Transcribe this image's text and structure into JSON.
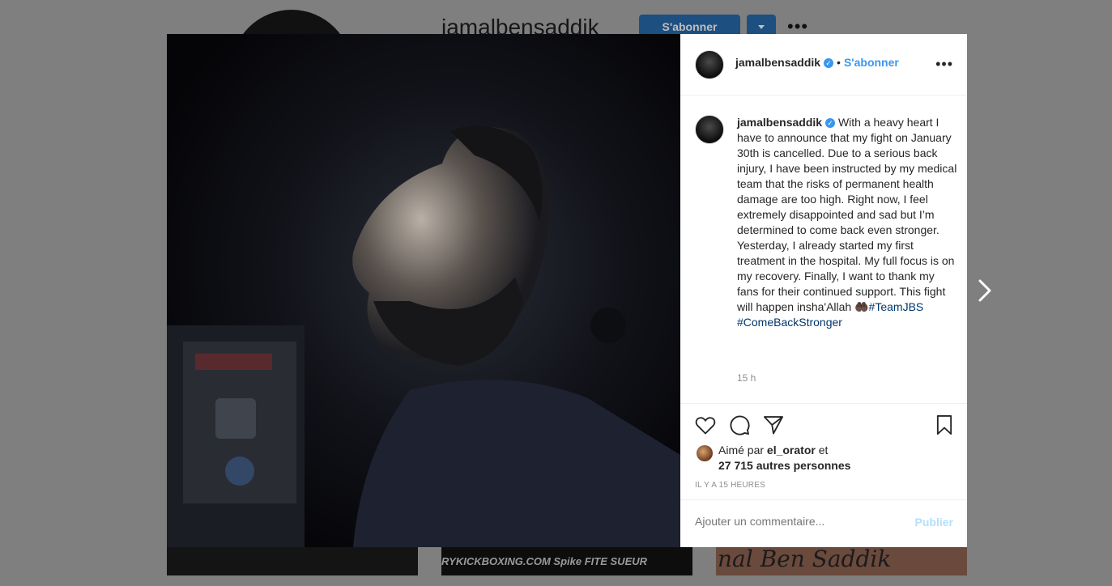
{
  "background": {
    "username": "jamalbensaddik",
    "follow_button": "S'abonner",
    "thumbnails": {
      "second_text": "RYKICKBOXING.COM  Spike  FITE  SUEUR",
      "third_text": "nal Ben Saddik"
    }
  },
  "post": {
    "header": {
      "username": "jamalbensaddik",
      "separator": "•",
      "follow_label": "S'abonner"
    },
    "caption": {
      "username": "jamalbensaddik",
      "text": "With a heavy heart I have to announce that my fight on January 30th is cancelled. Due to a serious back injury, I have been instructed by my medical team that the risks of permanent health damage are too high. Right now, I feel extremely disappointed and sad but I’m determined to come back even stronger. Yesterday, I already started my first treatment in the hospital. My full focus is on my recovery. Finally, I want to thank my fans for their continued support. This fight will happen insha'Allah ",
      "emoji": "🤲🏿",
      "hashtag1": "#TeamJBS",
      "hashtag2": "#ComeBackStronger",
      "time": "15 h"
    },
    "likes": {
      "prefix": "Aimé par ",
      "liker": "el_orator",
      "suffix": " et",
      "others": "27 715 autres personnes"
    },
    "timestamp": "IL Y A 15 HEURES",
    "comment": {
      "placeholder": "Ajouter un commentaire...",
      "publish": "Publier"
    }
  },
  "icons": [
    "heart-icon",
    "comment-icon",
    "share-icon",
    "bookmark-icon",
    "more-icon",
    "verified-icon",
    "next-arrow-icon"
  ],
  "colors": {
    "link": "#3897f0",
    "hashtag": "#003569",
    "muted": "#8e8e8e",
    "publish_disabled": "#b2dffc"
  }
}
